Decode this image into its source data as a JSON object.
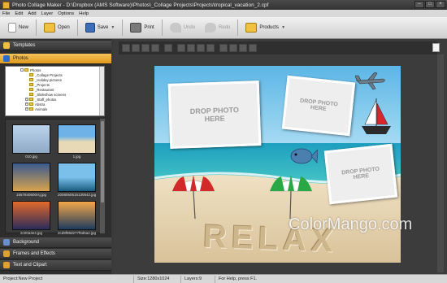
{
  "window": {
    "title": "Photo Collage Maker - D:\\Dropbox (AMS Software)\\Photos\\_Collage Projects\\Projects\\tropical_vacation_2.cpf"
  },
  "menu": [
    "File",
    "Edit",
    "Add",
    "Layer",
    "Options",
    "Help"
  ],
  "toolbar": {
    "new": "New",
    "open": "Open",
    "save": "Save",
    "print": "Print",
    "undo": "Undo",
    "redo": "Redo",
    "products": "Products"
  },
  "left_panel": {
    "templates": "Templates",
    "photos": "Photos",
    "background": "Background",
    "frames": "Frames and Effects",
    "text": "Text and Clipart",
    "tree": [
      {
        "label": "Photos",
        "level": 0,
        "expander": "-"
      },
      {
        "label": "_Collage Projects",
        "level": 1,
        "expander": ""
      },
      {
        "label": "_Holiday pictures",
        "level": 1,
        "expander": ""
      },
      {
        "label": "_Projects",
        "level": 1,
        "expander": ""
      },
      {
        "label": "_Restaurant",
        "level": 1,
        "expander": ""
      },
      {
        "label": "_Slideshow screens",
        "level": 1,
        "expander": ""
      },
      {
        "label": "_Staff_photos",
        "level": 1,
        "expander": "+"
      },
      {
        "label": "Abstra",
        "level": 1,
        "expander": "+"
      },
      {
        "label": "Animals",
        "level": 1,
        "expander": "+"
      }
    ],
    "thumbnails": [
      {
        "label": "010.jpg"
      },
      {
        "label": "1.jpg"
      },
      {
        "label": "1557840600rsj.jpg"
      },
      {
        "label": "2008050515130542.jpg"
      },
      {
        "label": "2c00a3e4.jpg"
      },
      {
        "label": "2cd9f98d277f6d6a2.jpg"
      }
    ]
  },
  "canvas": {
    "drop_text": "DROP PHOTO HERE",
    "sand_text": "RELAX"
  },
  "statusbar": {
    "project": "Project:New Project",
    "size": "Size:1280x1024",
    "layers": "Layers:9",
    "help": "For Help, press F1."
  },
  "watermark": "ColorMango.com"
}
